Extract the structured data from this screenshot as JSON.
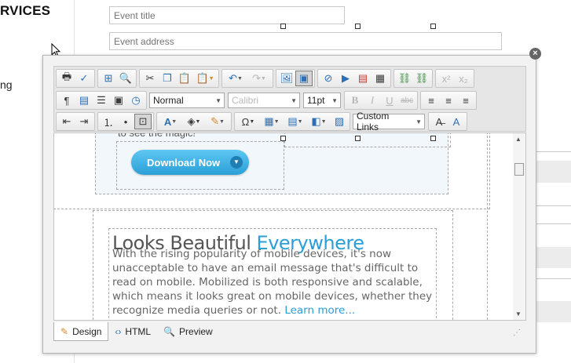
{
  "background_page": {
    "section_title": "RVICES",
    "side_text": "ng",
    "event_title_placeholder": "Event title",
    "event_address_placeholder": "Event address"
  },
  "editor": {
    "close_glyph": "×",
    "toolbar": {
      "paragraph_style": "Normal",
      "font_name": "Calibri",
      "font_size": "11pt",
      "bold": "B",
      "italic": "I",
      "underline": "U",
      "strike": "abc",
      "custom_links": "Custom Links",
      "superscript": "x²",
      "subscript": "x₂"
    },
    "content": {
      "hint_text": "to see the magic!",
      "download_button": "Download Now",
      "heading_plain": "Looks Beautiful",
      "heading_accent": "Everywhere",
      "paragraph": "With the rising popularity of mobile devices, it's now unacceptable to have an email message that's difficult to read on mobile. Mobilized is both responsive and scalable, which means it looks great on mobile devices, whether they recognize media queries or not.",
      "learn_more": "Learn more..."
    },
    "modes": [
      {
        "label": "Design",
        "icon": "pencil-icon",
        "active": true
      },
      {
        "label": "HTML",
        "icon": "code-icon",
        "active": false
      },
      {
        "label": "Preview",
        "icon": "magnifier-icon",
        "active": false
      }
    ]
  },
  "colors": {
    "accent": "#2a9fd7",
    "button_gradient_top": "#5fc7f2"
  }
}
